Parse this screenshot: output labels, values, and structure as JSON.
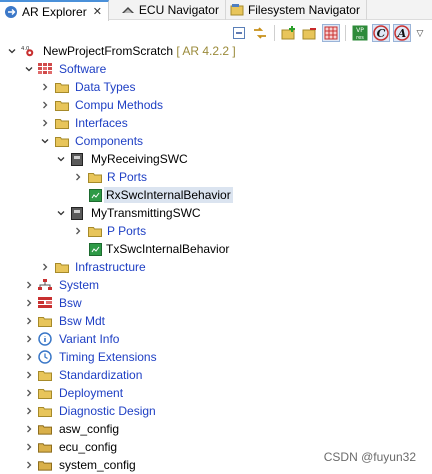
{
  "tabs": [
    {
      "label": "AR Explorer",
      "close": "✕",
      "active": true
    },
    {
      "label": "ECU Navigator",
      "active": false
    },
    {
      "label": "Filesystem Navigator",
      "active": false
    }
  ],
  "toolbar": {
    "buttons": [
      "collapse-all",
      "link-with-editor",
      "add-element",
      "remove-element",
      "filter",
      "vp-res",
      "c-toggle",
      "a-toggle"
    ],
    "vp_label": "VP\nres",
    "menu_caret": "▽"
  },
  "tree": {
    "root": {
      "label": "NewProjectFromScratch",
      "version": "[ AR 4.2.2 ]"
    },
    "software": "Software",
    "data_types": "Data Types",
    "compu_methods": "Compu Methods",
    "interfaces": "Interfaces",
    "components": "Components",
    "receiving_swc": "MyReceivingSWC",
    "r_ports": "R Ports",
    "rx_behavior": "RxSwcInternalBehavior",
    "transmitting_swc": "MyTransmittingSWC",
    "p_ports": "P Ports",
    "tx_behavior": "TxSwcInternalBehavior",
    "infrastructure": "Infrastructure",
    "system": "System",
    "bsw": "Bsw",
    "bsw_mdt": "Bsw Mdt",
    "variant_info": "Variant Info",
    "timing_extensions": "Timing Extensions",
    "standardization": "Standardization",
    "deployment": "Deployment",
    "diagnostic_design": "Diagnostic Design",
    "asw_config": "asw_config",
    "ecu_config": "ecu_config",
    "system_config": "system_config"
  },
  "watermark": "CSDN @fuyun32",
  "colors": {
    "link_blue": "#1e3fc4",
    "folder_yellow": "#e8c55a",
    "selection": "#dbe4f0",
    "version": "#9a8a3a"
  }
}
